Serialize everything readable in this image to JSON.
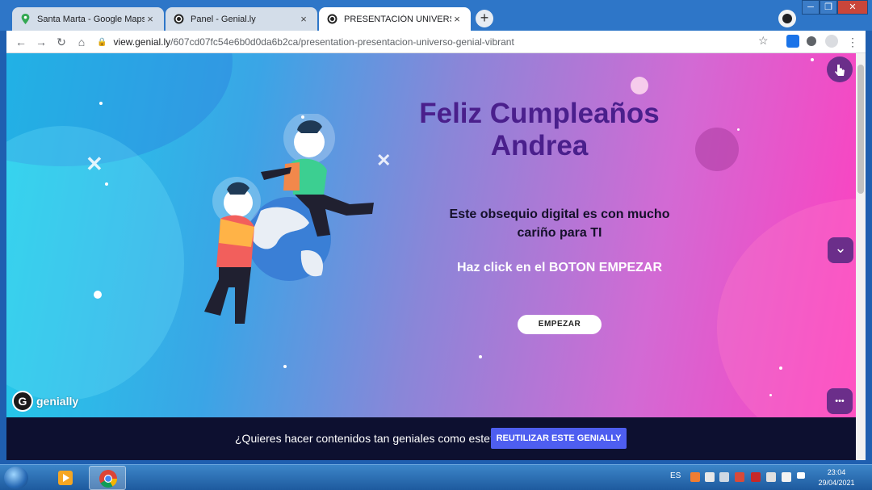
{
  "browser": {
    "tabs": [
      {
        "title": "Santa Marta - Google Maps",
        "active": false,
        "close_label": "×"
      },
      {
        "title": "Panel - Genial.ly",
        "active": false,
        "close_label": "×"
      },
      {
        "title": "PRESENTACIÓN UNIVERSO GENI",
        "active": true,
        "close_label": "×"
      }
    ],
    "new_tab_label": "+",
    "url_host": "view.genial.ly",
    "url_path": "/607cd07fc54e6b0d0da6b2ca/presentation-presentacion-universo-genial-vibrant",
    "window_controls": {
      "minimize": "─",
      "maximize": "❐",
      "close": "✕"
    }
  },
  "slide": {
    "headline_line1": "Feliz Cumpleaños",
    "headline_line2": "Andrea",
    "subtitle_line1": "Este obsequio digital es con mucho",
    "subtitle_line2": "cariño para TI",
    "instruction": "Haz click en el BOTON EMPEZAR",
    "start_button": "EMPEZAR",
    "brand": "genially",
    "brand_logo_letter": "G",
    "more_button": "•••",
    "down_button": "⌄"
  },
  "promo": {
    "text": "¿Quieres hacer contenidos tan geniales como este?",
    "button": "REUTILIZAR ESTE GENIALLY"
  },
  "taskbar": {
    "language": "ES",
    "time": "23:04",
    "date": "29/04/2021"
  },
  "colors": {
    "headline": "#4a1f8c",
    "promo_bg": "#0d1030",
    "promo_button": "#4e5ef0",
    "genially_button": "#6b2e8a"
  }
}
